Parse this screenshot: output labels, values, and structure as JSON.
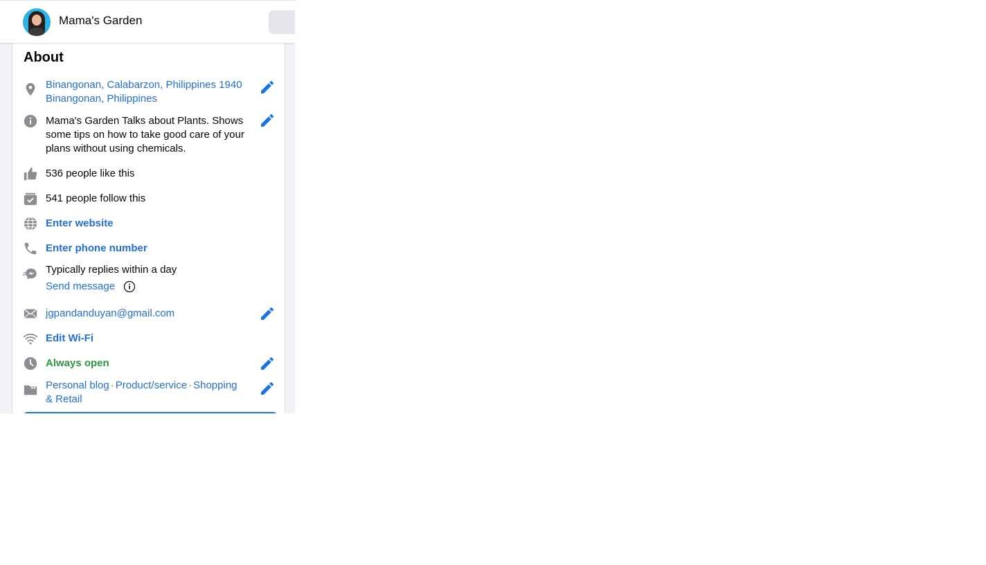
{
  "header": {
    "page_name": "Mama's Garden"
  },
  "about": {
    "title": "About",
    "address_line1": "Binangonan, Calabarzon, Philippines 1940",
    "address_line2": "Binangonan, Philippines",
    "description": "Mama's Garden Talks about Plants. Shows some tips on how to take good care of your plans without using chemicals.",
    "likes": "536 people like this",
    "follows": "541 people follow this",
    "website": "Enter website",
    "phone": "Enter phone number",
    "reply_time": "Typically replies within a day",
    "send_message": "Send message",
    "email": "jgpandanduyan@gmail.com",
    "wifi": "Edit Wi-Fi",
    "hours": "Always open",
    "categories": [
      "Personal blog",
      "Product/service",
      "Shopping & Retail"
    ]
  },
  "colors": {
    "link": "#216fdb",
    "icon_gray": "#8a8d91",
    "open_green": "#2b9a3e",
    "edit_blue": "#1b74e4"
  },
  "icons": [
    "location-pin-icon",
    "info-icon",
    "thumbs-up-icon",
    "follow-check-icon",
    "globe-icon",
    "phone-icon",
    "messenger-icon",
    "mail-icon",
    "wifi-icon",
    "clock-icon",
    "category-icon",
    "pencil-icon"
  ]
}
